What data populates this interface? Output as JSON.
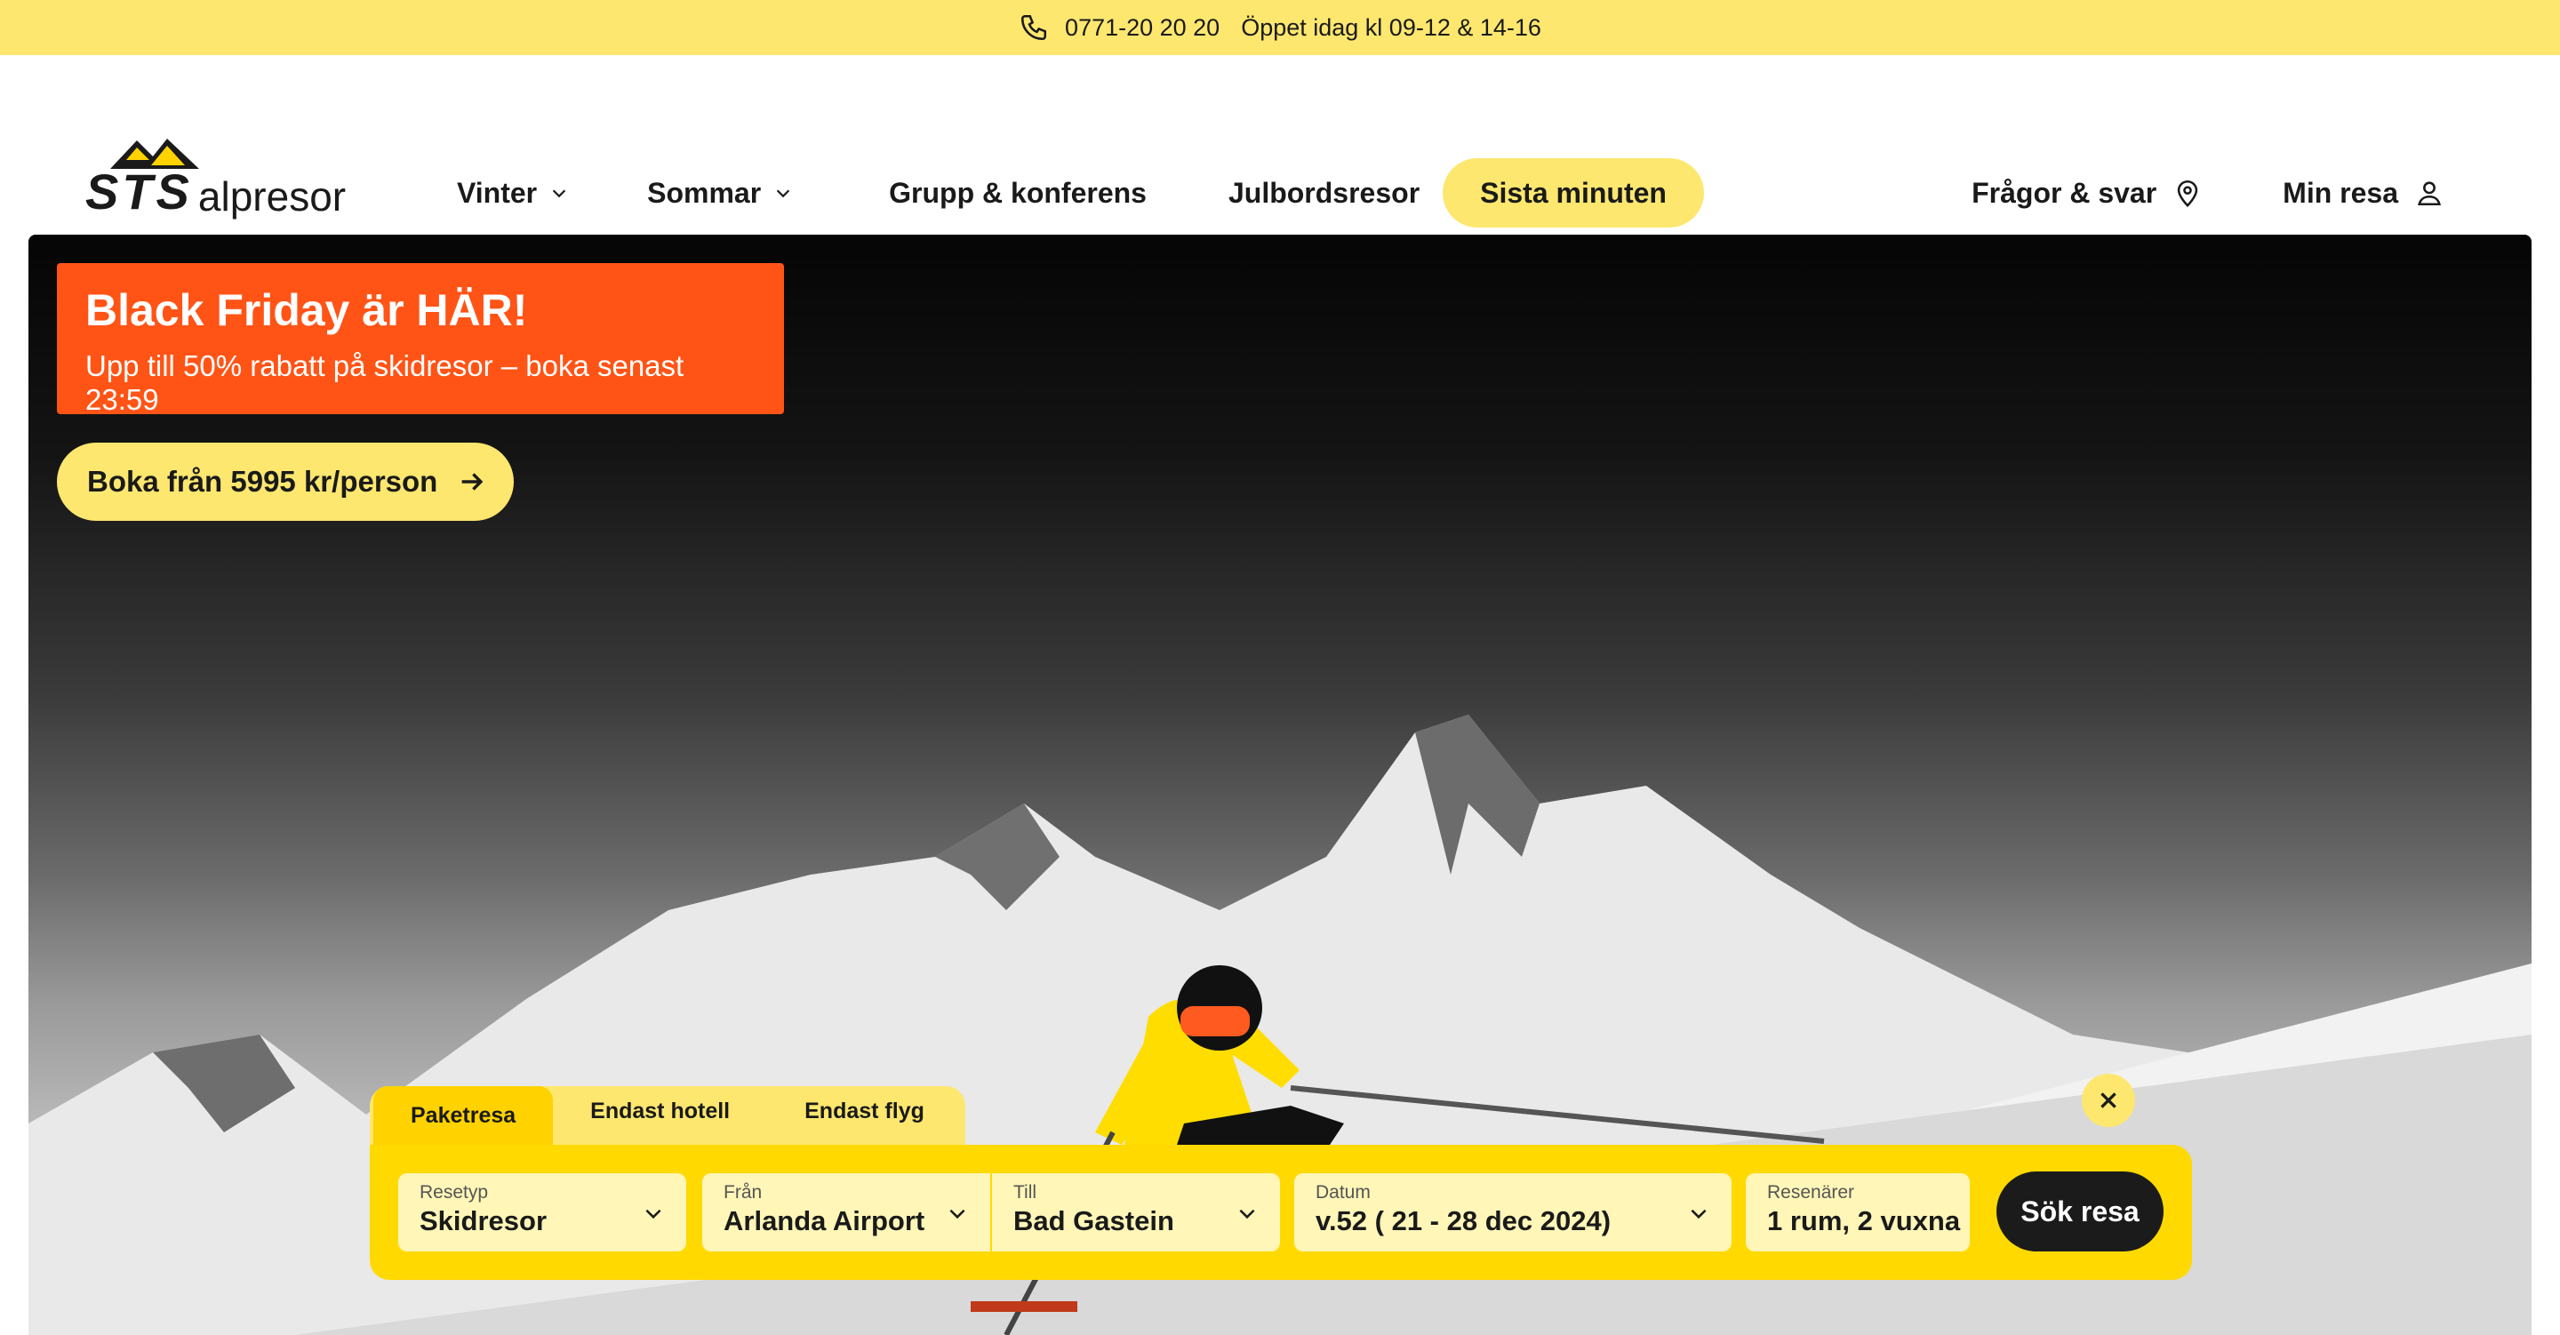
{
  "topbar": {
    "phone": "0771-20 20 20",
    "hours": "Öppet idag kl 09-12 & 14-16"
  },
  "logo": {
    "mark": "STS",
    "name": "alpresor"
  },
  "nav": {
    "items": [
      {
        "label": "Vinter",
        "dropdown": true
      },
      {
        "label": "Sommar",
        "dropdown": true
      },
      {
        "label": "Grupp & konferens"
      },
      {
        "label": "Julbordsresor"
      },
      {
        "label": "Sista minuten"
      }
    ],
    "faq": "Frågor & svar",
    "account": "Min resa"
  },
  "promo": {
    "title": "Black Friday är HÄR!",
    "subtitle": "Upp till 50% rabatt på skidresor – boka senast 23:59",
    "cta": "Boka från 5995 kr/person"
  },
  "search": {
    "tabs": [
      "Paketresa",
      "Endast hotell",
      "Endast flyg"
    ],
    "fields": [
      {
        "label": "Resetyp",
        "value": "Skidresor"
      },
      {
        "label": "Från",
        "value": "Arlanda Airport"
      },
      {
        "label": "Till",
        "value": "Bad Gastein"
      },
      {
        "label": "Datum",
        "value": "v.52 ( 21 - 28 dec 2024)"
      },
      {
        "label": "Resenärer",
        "value": "1 rum, 2 vuxna"
      }
    ],
    "submit": "Sök resa"
  },
  "colors": {
    "yellow": "#fde76f",
    "search_yellow": "#ffd900",
    "promo_orange": "#ff5416",
    "dark": "#1b1b1b"
  },
  "icons": [
    "phone-icon",
    "chevron-down-icon",
    "location-pin-icon",
    "user-icon",
    "arrow-right-icon",
    "close-icon"
  ]
}
